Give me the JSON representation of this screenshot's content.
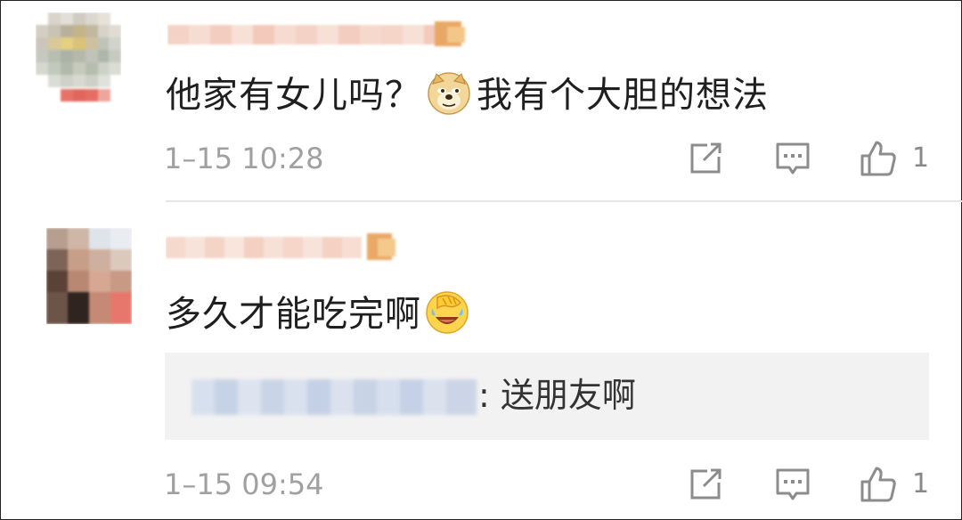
{
  "comments": [
    {
      "text": "他家有女儿吗？",
      "emoji": "doge-emoji",
      "text_after": "我有个大胆的想法",
      "time": "1–15 10:28",
      "likes": "1"
    },
    {
      "text": "多久才能吃完啊",
      "emoji": "facepalm-laugh-emoji",
      "reply": {
        "text": ": 送朋友啊"
      },
      "time": "1–15 09:54",
      "likes": "1"
    }
  ],
  "icons": {
    "share": "share-icon",
    "reply": "comment-icon",
    "like": "thumbs-up-icon"
  },
  "colors": {
    "text": "#1f1f1f",
    "meta": "#a0a0a0",
    "reply_bg": "#f2f2f2",
    "divider": "#e6e6e6"
  }
}
